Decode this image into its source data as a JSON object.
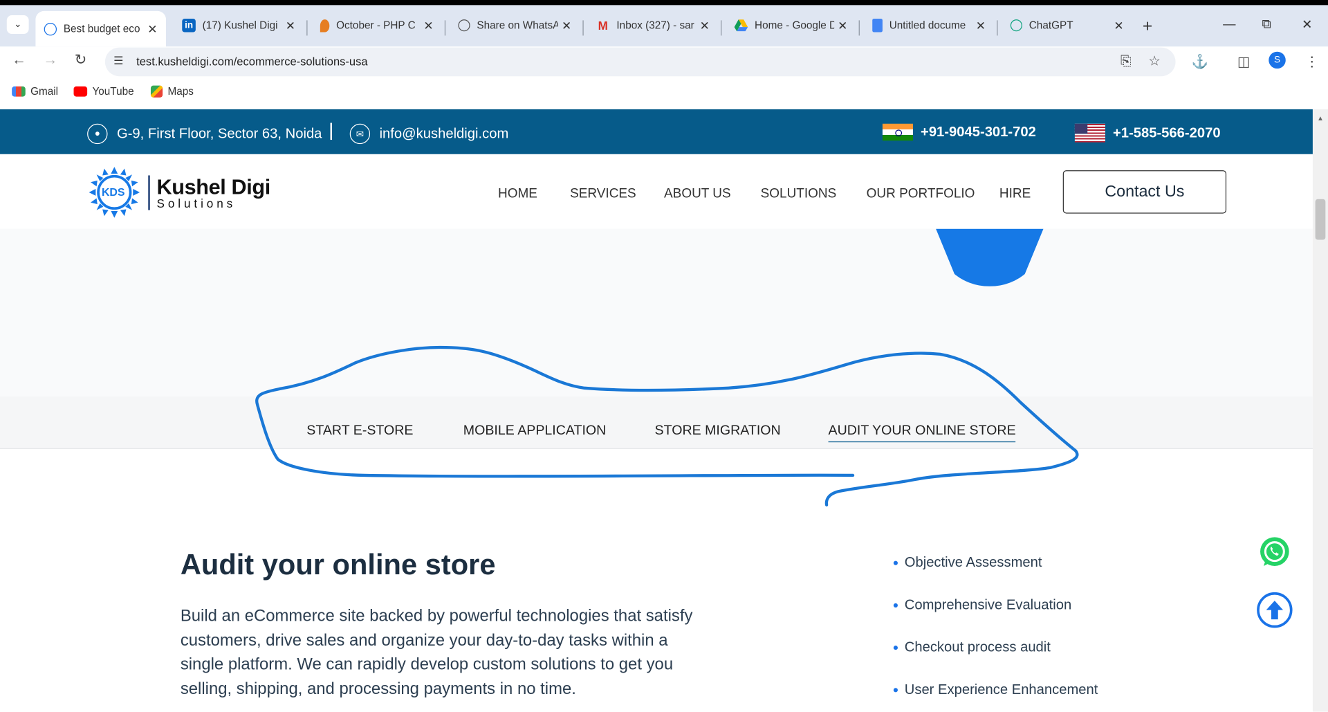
{
  "browser": {
    "tabs": [
      {
        "title": "Best budget eco",
        "active": true
      },
      {
        "title": "(17) Kushel Digi"
      },
      {
        "title": "October - PHP C"
      },
      {
        "title": "Share on WhatsA"
      },
      {
        "title": "Inbox (327) - sar"
      },
      {
        "title": "Home - Google D"
      },
      {
        "title": "Untitled docume"
      },
      {
        "title": "ChatGPT"
      }
    ],
    "url": "test.kusheldigi.com/ecommerce-solutions-usa",
    "profile_initial": "S",
    "bookmarks": [
      "Gmail",
      "YouTube",
      "Maps"
    ]
  },
  "topbar": {
    "address": "G-9, First Floor, Sector 63, Noida",
    "email": "info@kusheldigi.com",
    "phone_india": "+91-9045-301-702",
    "phone_usa": "+1-585-566-2070"
  },
  "header": {
    "logo_mark": "KDS",
    "logo_name": "Kushel Digi",
    "logo_sub": "Solutions",
    "nav": [
      "HOME",
      "SERVICES",
      "ABOUT US",
      "SOLUTIONS",
      "OUR PORTFOLIO",
      "HIRE"
    ],
    "contact_label": "Contact Us"
  },
  "solution_tabs": {
    "items": [
      "START E-STORE",
      "MOBILE APPLICATION",
      "STORE MIGRATION",
      "AUDIT YOUR ONLINE STORE"
    ],
    "active": "AUDIT YOUR ONLINE STORE"
  },
  "content": {
    "heading": "Audit your online store",
    "paragraph": "Build an eCommerce site backed by powerful technologies that satisfy customers, drive sales and organize your day-to-day tasks within a single platform. We can rapidly develop custom solutions to get you selling, shipping, and processing payments in no time.",
    "bullets": [
      "Objective Assessment",
      "Comprehensive Evaluation",
      "Checkout process audit",
      "User Experience Enhancement"
    ]
  },
  "colors": {
    "topbar_bg": "#065b8a",
    "accent_blue": "#1679e6",
    "annotation_stroke": "#1a78d6"
  }
}
